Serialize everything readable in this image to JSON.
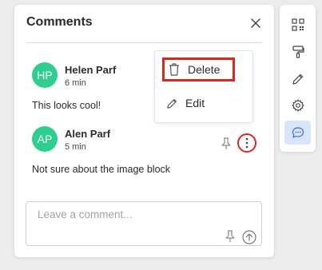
{
  "panel": {
    "title": "Comments"
  },
  "comments": [
    {
      "initials": "HP",
      "author": "Helen Parf",
      "time": "6 min",
      "text": "This looks cool!",
      "avatar_color": "#2ecf8e"
    },
    {
      "initials": "AP",
      "author": "Alen Parf",
      "time": "5 min",
      "text": "Not sure about the image block",
      "avatar_color": "#2ecf8e"
    }
  ],
  "context_menu": {
    "delete_label": "Delete",
    "edit_label": "Edit"
  },
  "composer": {
    "placeholder": "Leave a comment..."
  },
  "toolbar": {
    "tools": [
      "qr-code-icon",
      "paint-roller-icon",
      "pencil-icon",
      "settings-icon",
      "comment-icon"
    ],
    "active": "comment-icon"
  },
  "colors": {
    "highlight": "#e0261b",
    "active_tool_bg": "#d8e4fb",
    "active_tool_icon": "#3b6fd8"
  }
}
